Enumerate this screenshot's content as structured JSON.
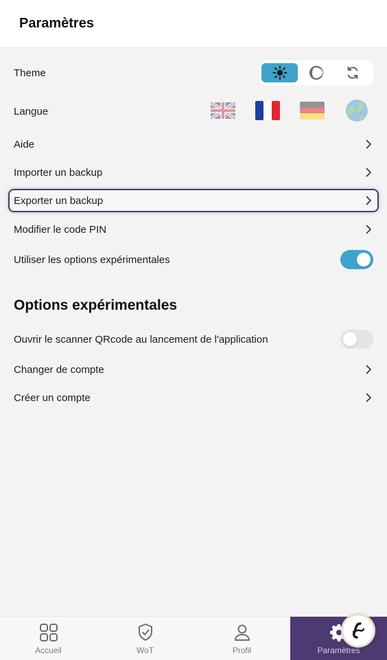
{
  "header": {
    "title": "Paramètres"
  },
  "settings": {
    "theme_label": "Theme",
    "theme_options": [
      {
        "icon": "sun-icon",
        "active": true
      },
      {
        "icon": "moon-icon",
        "active": false
      },
      {
        "icon": "sync-icon",
        "active": false
      }
    ],
    "language_label": "Langue",
    "languages": [
      "uk-flag-icon",
      "fr-flag-icon",
      "de-flag-icon",
      "globe-icon"
    ],
    "help_label": "Aide",
    "import_label": "Importer un backup",
    "export_label": "Exporter un backup",
    "pin_label": "Modifier le code PIN",
    "experimental_label": "Utiliser les options expérimentales",
    "experimental_enabled": true
  },
  "experimental": {
    "title": "Options expérimentales",
    "scanner_label": "Ouvrir le scanner QRcode au lancement de l'application",
    "scanner_enabled": false,
    "switch_account_label": "Changer de compte",
    "create_account_label": "Créer un compte"
  },
  "tabbar": {
    "home": "Accueil",
    "wot": "WoT",
    "profile": "Profil",
    "settings": "Paramètres"
  },
  "colors": {
    "accent": "#3ea3c9",
    "nav_active": "#4c3a72"
  }
}
